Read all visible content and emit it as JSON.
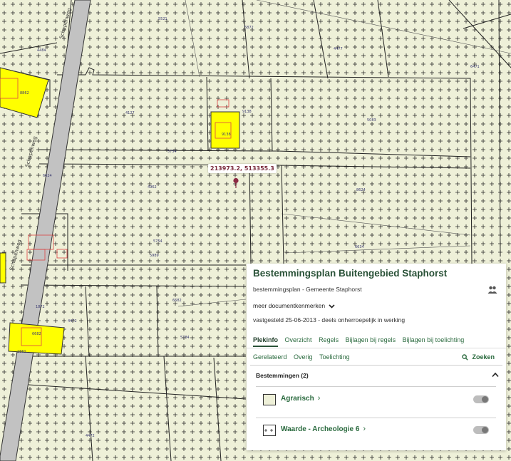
{
  "map": {
    "coordinate_readout": "213973.2, 513355.3",
    "road_label": "Schapenweg",
    "parcel_labels": [
      "4484",
      "8862",
      "4127",
      "5521",
      "9138",
      "5754",
      "6624",
      "4962",
      "5872",
      "4477",
      "5083",
      "8624",
      "5754",
      "6634",
      "1872",
      "4472",
      "6682",
      "9138",
      "5784",
      "1861",
      "5989",
      "6471",
      "6682",
      "4472"
    ],
    "colors": {
      "base": "#eef0d8",
      "building": "#ffff00",
      "road": "#c2c2c2",
      "pin": "#8c2a44"
    }
  },
  "panel": {
    "title": "Bestemmingsplan Buitengebied Staphorst",
    "subtitle": "bestemmingsplan - Gemeente Staphorst",
    "more_docs": "meer documentkenmerken",
    "status": "vastgesteld 25-06-2013 - deels onherroepelijk in werking",
    "tabs_row1": [
      "Plekinfo",
      "Overzicht",
      "Regels",
      "Bijlagen bij regels",
      "Bijlagen bij toelichting"
    ],
    "tabs_row2": [
      "Gerelateerd",
      "Overig",
      "Toelichting"
    ],
    "search_label": "Zoeken",
    "section_title": "Bestemmingen (2)",
    "items": [
      {
        "label": "Agrarisch",
        "enabled": false
      },
      {
        "label": "Waarde - Archeologie 6",
        "enabled": false
      }
    ],
    "icons": [
      "people-icon",
      "chevron-down-icon",
      "search-icon",
      "chevron-up-icon",
      "chevron-right-icon"
    ]
  }
}
